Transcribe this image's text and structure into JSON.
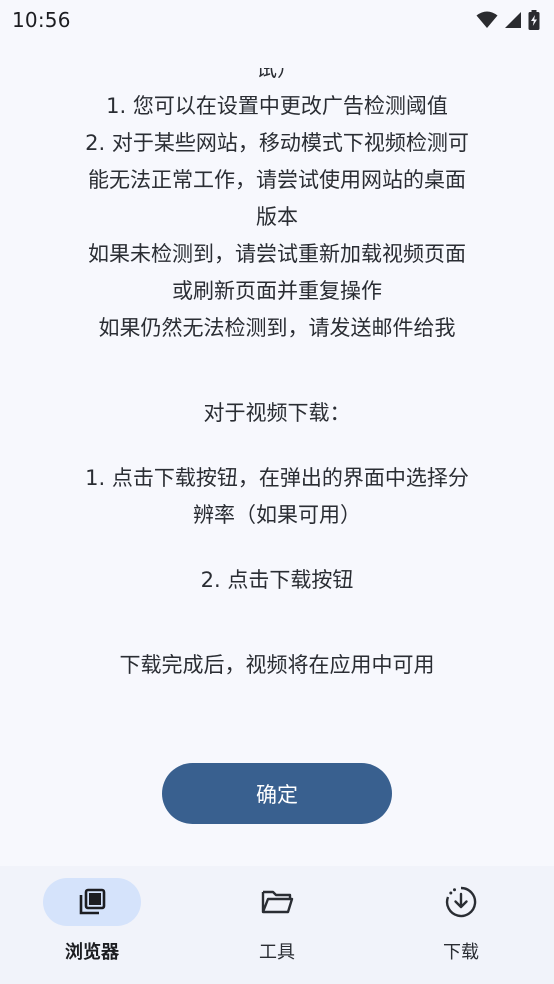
{
  "status_bar": {
    "time": "10:56"
  },
  "content": {
    "cut_line": "试）",
    "lines_a": [
      "1. 您可以在设置中更改广告检测阈值",
      "2. 对于某些网站，移动模式下视频检测可",
      "能无法正常工作，请尝试使用网站的桌面",
      "版本",
      "如果未检测到，请尝试重新加载视频页面",
      "或刷新页面并重复操作",
      "如果仍然无法检测到，请发送邮件给我"
    ],
    "download_heading": "对于视频下载：",
    "step1_lines": [
      "1. 点击下载按钮，在弹出的界面中选择分",
      "辨率（如果可用）"
    ],
    "step2": "2. 点击下载按钮",
    "completion": "下载完成后，视频将在应用中可用"
  },
  "ok_button": {
    "label": "确定"
  },
  "bottom_nav": {
    "items": [
      {
        "label": "浏览器",
        "icon": "tabs-icon",
        "active": true
      },
      {
        "label": "工具",
        "icon": "folder-icon",
        "active": false
      },
      {
        "label": "下载",
        "icon": "download-circle-icon",
        "active": false
      }
    ]
  },
  "colors": {
    "primary": "#39608f",
    "active_pill": "#d5e3fb",
    "background": "#f7f8fd"
  }
}
